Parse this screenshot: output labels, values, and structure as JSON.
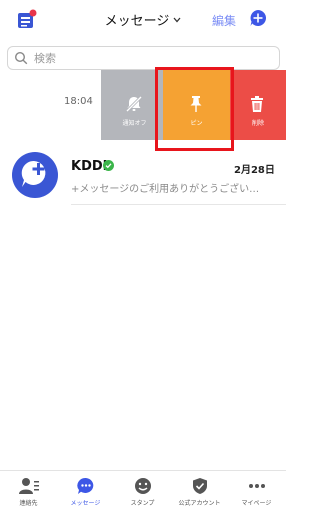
{
  "header": {
    "title": "メッセージ",
    "edit_label": "編集"
  },
  "search": {
    "placeholder": "検索"
  },
  "swiped_row": {
    "time": "18:04",
    "actions": {
      "mute": "通知オフ",
      "pin": "ピン",
      "delete": "削除"
    }
  },
  "conversation": {
    "name": "KDDI",
    "date": "2月28日",
    "preview": "+メッセージのご利用ありがとうござい…"
  },
  "tabs": [
    {
      "label": "連絡先",
      "icon": "contacts-icon"
    },
    {
      "label": "メッセージ",
      "icon": "chat-icon"
    },
    {
      "label": "スタンプ",
      "icon": "sticker-icon"
    },
    {
      "label": "公式アカウント",
      "icon": "official-account-icon"
    },
    {
      "label": "マイページ",
      "icon": "more-icon"
    }
  ],
  "colors": {
    "accent": "#3d57e6",
    "mute": "#b4b6bb",
    "pin": "#f5a233",
    "delete": "#ec4d47",
    "highlight": "#e8151c"
  }
}
